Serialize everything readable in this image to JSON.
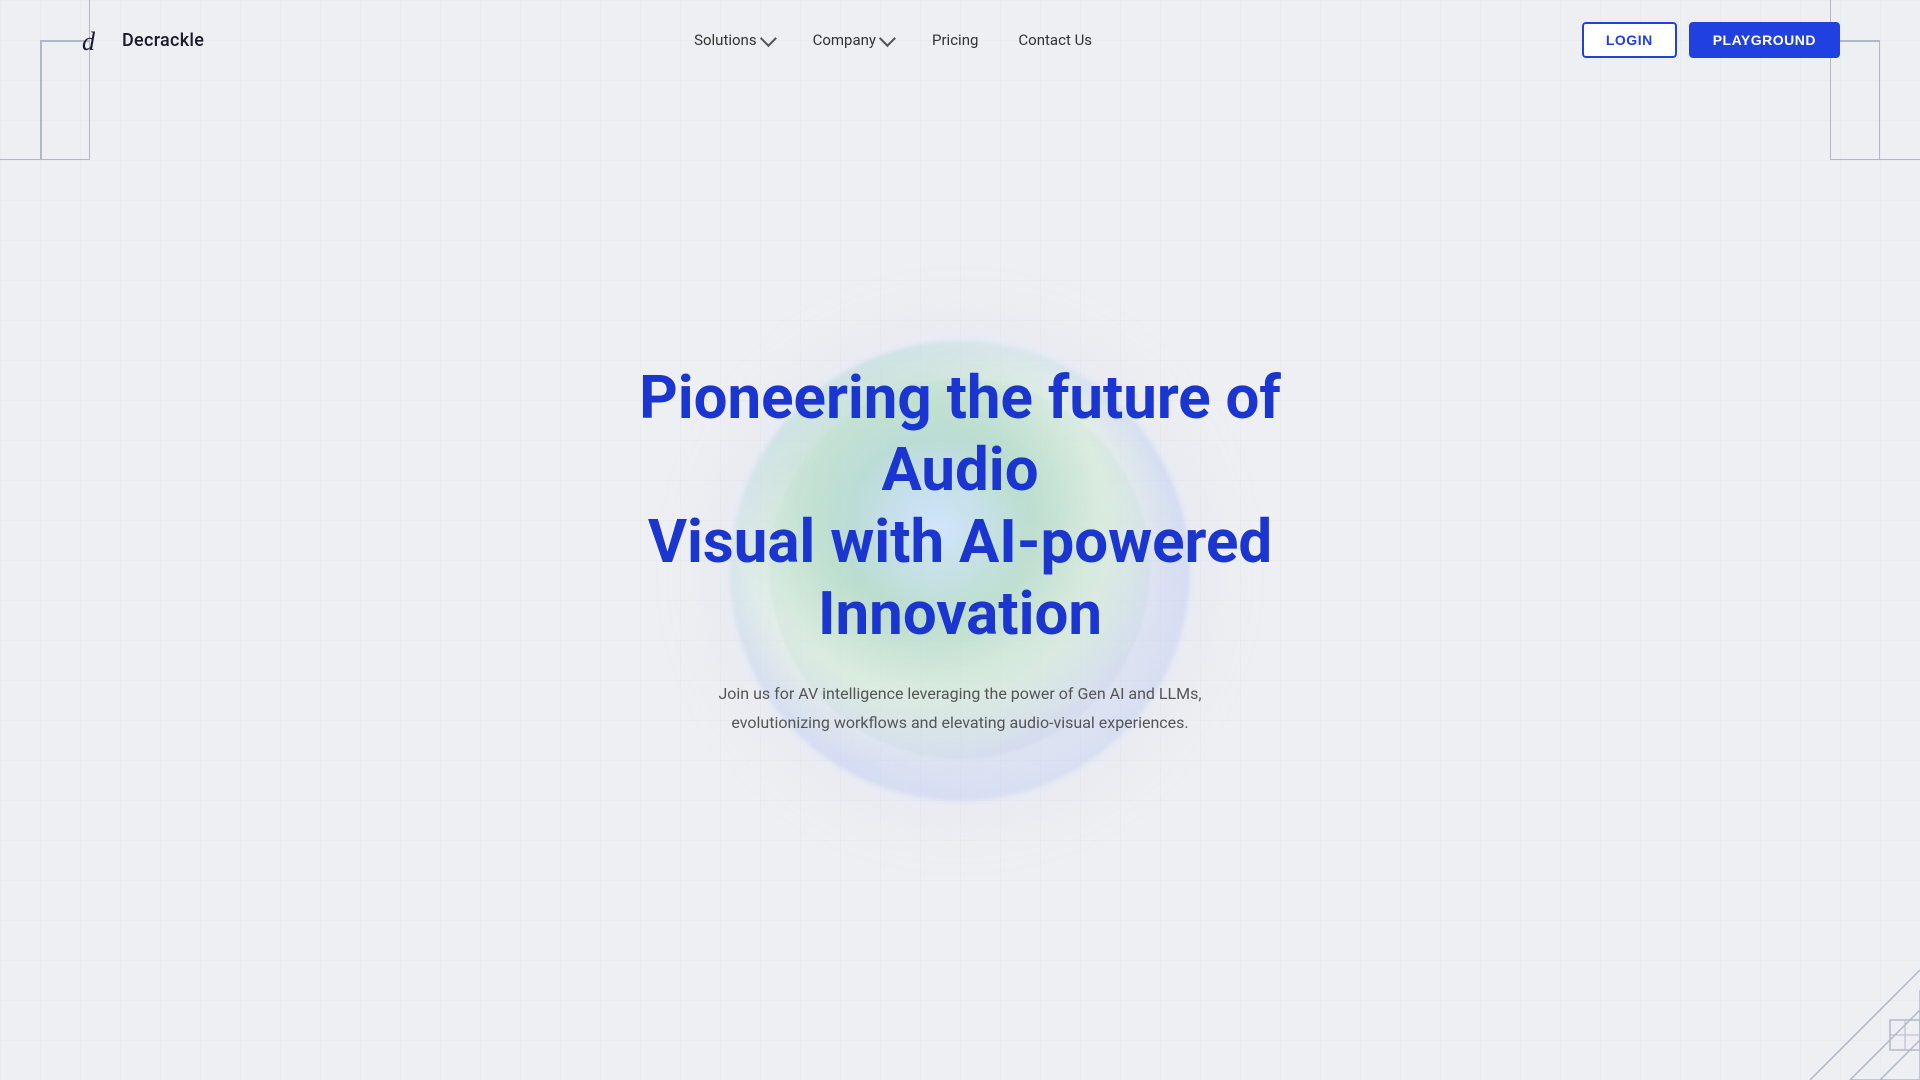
{
  "brand": {
    "name": "Decrackle",
    "logo_unicode": "d"
  },
  "nav": {
    "items": [
      {
        "label": "Solutions",
        "has_dropdown": true
      },
      {
        "label": "Company",
        "has_dropdown": true
      },
      {
        "label": "Pricing",
        "has_dropdown": false
      },
      {
        "label": "Contact Us",
        "has_dropdown": false
      }
    ],
    "login_label": "LOGIN",
    "playground_label": "PLAYGROUND"
  },
  "hero": {
    "title_line1": "Pioneering the future of Audio",
    "title_line2": "Visual with AI-powered Innovation",
    "subtitle": "Join us for AV intelligence leveraging the power of Gen AI and LLMs, evolutionizing workflows and elevating audio-visual experiences."
  },
  "colors": {
    "primary_blue": "#1a35d0",
    "nav_text": "#333333",
    "subtitle_text": "#555555",
    "bg": "#f0f0f0",
    "border_blue": "#2040e0",
    "corner_lines": "#b0b8c8"
  }
}
